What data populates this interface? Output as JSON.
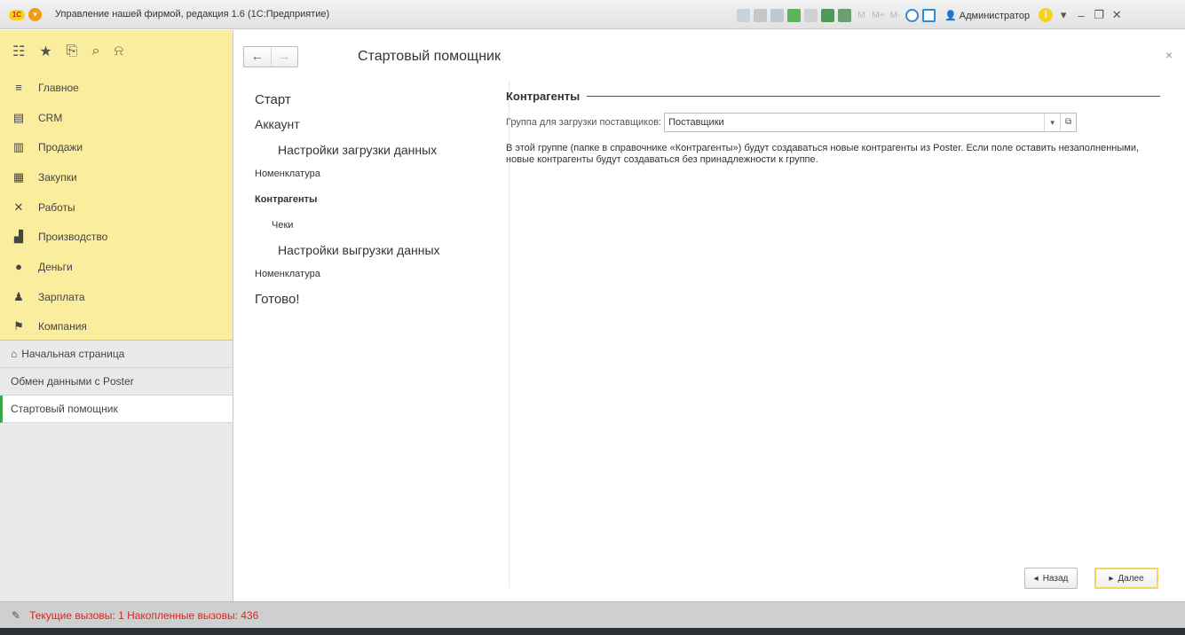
{
  "window": {
    "title": "Управление нашей фирмой, редакция 1.6  (1С:Предприятие)",
    "user": "Администратор",
    "toolbar_icons": [
      "doc-icon",
      "print-icon",
      "preview-icon",
      "upload-icon",
      "save-icon",
      "table-icon",
      "calendar-icon",
      "m-icon",
      "m-plus-icon",
      "m-minus-icon",
      "zoom-icon",
      "panel-icon"
    ],
    "memory_labels": [
      "M",
      "M+",
      "M-"
    ]
  },
  "sidebar": {
    "tool_icons": [
      "apps-grid-icon",
      "star-icon",
      "history-icon",
      "search-icon",
      "bell-icon"
    ],
    "sections": [
      {
        "label": "Главное",
        "icon": "menu-icon"
      },
      {
        "label": "CRM",
        "icon": "crm-icon"
      },
      {
        "label": "Продажи",
        "icon": "sales-icon"
      },
      {
        "label": "Закупки",
        "icon": "purchases-icon"
      },
      {
        "label": "Работы",
        "icon": "tools-icon"
      },
      {
        "label": "Производство",
        "icon": "factory-icon"
      },
      {
        "label": "Деньги",
        "icon": "money-icon"
      },
      {
        "label": "Зарплата",
        "icon": "people-icon"
      },
      {
        "label": "Компания",
        "icon": "flag-icon"
      }
    ],
    "open_pages": [
      {
        "label": "Начальная страница"
      },
      {
        "label": "Обмен данными с Poster"
      },
      {
        "label": "Стартовый помощник"
      }
    ]
  },
  "main": {
    "title": "Стартовый помощник",
    "steps": [
      {
        "label": "Старт"
      },
      {
        "label": "Аккаунт"
      },
      {
        "label": "Настройки загрузки данных"
      },
      {
        "label": "Номенклатура"
      },
      {
        "label": "Контрагенты"
      },
      {
        "label": "Чеки"
      },
      {
        "label": "Настройки выгрузки данных"
      },
      {
        "label": "Номенклатура"
      },
      {
        "label": "Готово!"
      }
    ],
    "section_title": "Контрагенты",
    "field_label": "Группа для загрузки поставщиков:",
    "field_value": "Поставщики",
    "description": "В этой группе (папке в справочнике «Контрагенты») будут создаваться новые контрагенты из Poster. Если поле оставить незаполненными, новые контрагенты будут создаваться без принадлежности к группе.",
    "back_label": "Назад",
    "next_label": "Далее"
  },
  "statusbar": {
    "text": "Текущие вызовы: 1   Накопленные вызовы: 436"
  }
}
